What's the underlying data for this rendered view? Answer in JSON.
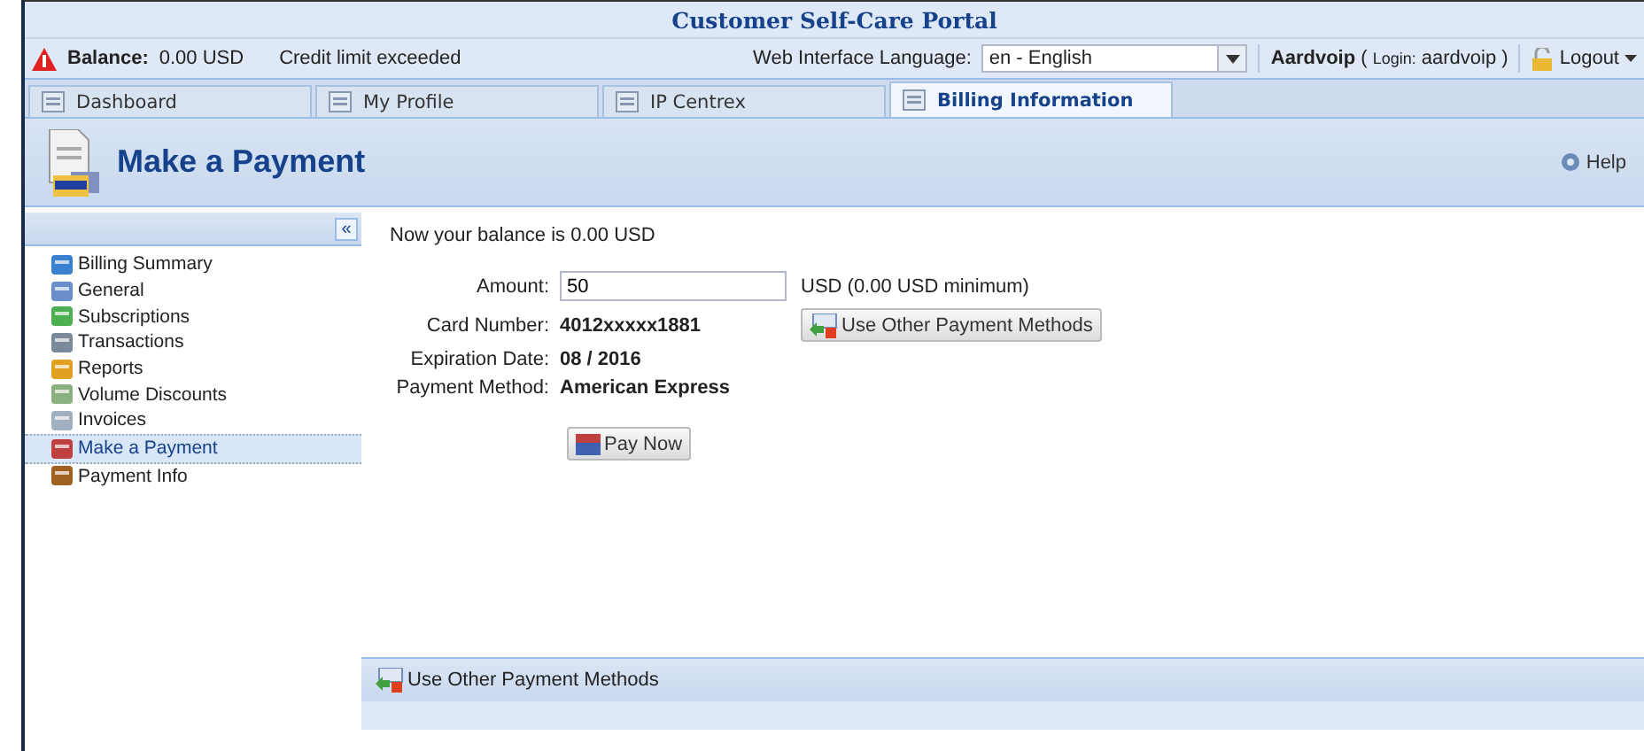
{
  "window": {
    "title": "Customer Self-Care Portal"
  },
  "status_bar": {
    "balance_label": "Balance:",
    "balance": "0.00 USD",
    "alert": "Credit limit exceeded",
    "language_label": "Web Interface Language:",
    "language": "en - English",
    "account": "Aardvoip",
    "login_open": "(",
    "login_label": "Login:",
    "login": "aardvoip",
    "login_close": ")",
    "logout": "Logout"
  },
  "tabs": [
    {
      "label": "Dashboard",
      "selected": false
    },
    {
      "label": "My Profile",
      "selected": false
    },
    {
      "label": "IP Centrex",
      "selected": false
    },
    {
      "label": "Billing Information",
      "selected": true
    }
  ],
  "header": {
    "title": "Make a Payment",
    "help": "Help"
  },
  "sidebar": {
    "collapse": "«",
    "items": [
      {
        "label": "Billing Summary",
        "selected": false
      },
      {
        "label": "General",
        "selected": false
      },
      {
        "label": "Subscriptions",
        "selected": false
      },
      {
        "label": "Transactions",
        "selected": false
      },
      {
        "label": "Reports",
        "selected": false
      },
      {
        "label": "Volume Discounts",
        "selected": false
      },
      {
        "label": "Invoices",
        "selected": false
      },
      {
        "label": "Make a Payment",
        "selected": true
      },
      {
        "label": "Payment Info",
        "selected": false
      }
    ]
  },
  "payment": {
    "balance_note": "Now your balance is 0.00 USD",
    "amount_label": "Amount:",
    "amount": "50",
    "amount_hint": "USD (0.00 USD minimum)",
    "other_methods": "Use Other Payment Methods",
    "details": [
      {
        "label": "Card Number:",
        "value": "4012xxxxx1881"
      },
      {
        "label": "Expiration Date:",
        "value": "08 / 2016"
      },
      {
        "label": "Payment Method:",
        "value": "American Express"
      }
    ],
    "pay": "Pay Now"
  },
  "footer_panel": {
    "action": "Use Other Payment Methods"
  }
}
